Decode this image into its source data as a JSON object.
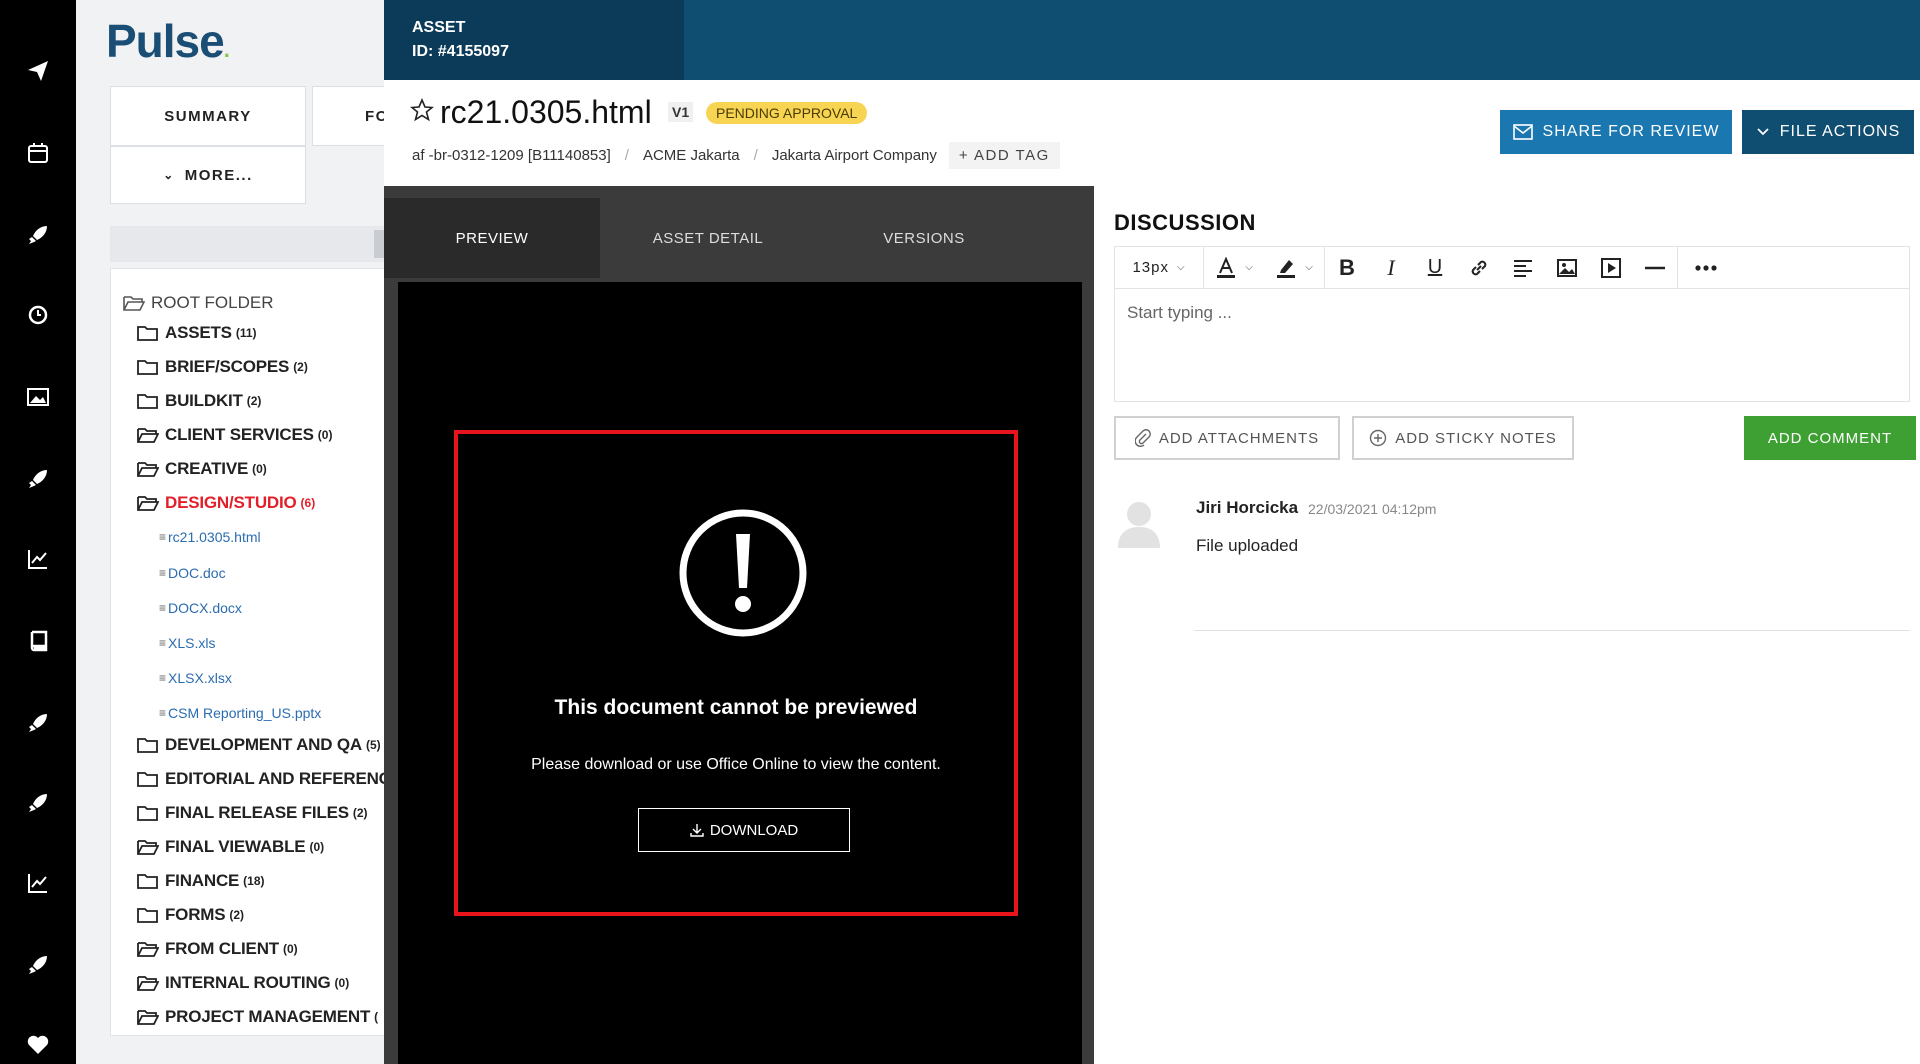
{
  "app": {
    "logo_text": "Pulse",
    "logo_dot": "."
  },
  "rail": {
    "icons": [
      "paper-plane-icon",
      "calendar-icon",
      "rocket-icon",
      "clock-icon",
      "image-icon",
      "rocket-icon",
      "chart-line-icon",
      "book-icon",
      "rocket-icon",
      "rocket-icon",
      "chart-line-icon",
      "rocket-icon",
      "heart-icon"
    ]
  },
  "folder_panel": {
    "tabs": {
      "summary": "SUMMARY",
      "second": "FO",
      "more": "MORE..."
    },
    "root": "ROOT FOLDER",
    "folders": [
      {
        "name": "ASSETS",
        "count": "(11)"
      },
      {
        "name": "BRIEF/SCOPES",
        "count": "(2)"
      },
      {
        "name": "BUILDKIT",
        "count": "(2)"
      },
      {
        "name": "CLIENT SERVICES",
        "count": "(0)"
      },
      {
        "name": "CREATIVE",
        "count": "(0)"
      },
      {
        "name": "DESIGN/STUDIO",
        "count": "(6)",
        "active": true
      },
      {
        "name": "DEVELOPMENT AND QA",
        "count": "(5)"
      },
      {
        "name": "EDITORIAL AND REFERENCE",
        "count": ""
      },
      {
        "name": "FINAL RELEASE FILES",
        "count": "(2)"
      },
      {
        "name": "FINAL VIEWABLE",
        "count": "(0)"
      },
      {
        "name": "FINANCE",
        "count": "(18)"
      },
      {
        "name": "FORMS",
        "count": "(2)"
      },
      {
        "name": "FROM CLIENT",
        "count": "(0)"
      },
      {
        "name": "INTERNAL ROUTING",
        "count": "(0)"
      },
      {
        "name": "PROJECT MANAGEMENT",
        "count": "("
      }
    ],
    "files": [
      "rc21.0305.html",
      "DOC.doc",
      "DOCX.docx",
      "XLS.xls",
      "XLSX.xlsx",
      "CSM Reporting_US.pptx"
    ]
  },
  "asset": {
    "label": "ASSET",
    "id": "ID: #4155097",
    "title": "rc21.0305.html",
    "version": "V1",
    "status": "PENDING APPROVAL",
    "breadcrumb": [
      "af -br-0312-1209 [B11140853]",
      "ACME Jakarta",
      "Jakarta Airport Company"
    ],
    "add_tag": "+ ADD TAG",
    "share_button": "SHARE FOR REVIEW",
    "file_actions_button": "FILE ACTIONS"
  },
  "preview": {
    "tabs": [
      "PREVIEW",
      "ASSET DETAIL",
      "VERSIONS"
    ],
    "error_title": "This document cannot be previewed",
    "error_message": "Please download or use Office Online to view the content.",
    "download_label": "DOWNLOAD"
  },
  "discussion": {
    "title": "DISCUSSION",
    "font_size": "13px",
    "placeholder": "Start typing ...",
    "attach_label": "ADD ATTACHMENTS",
    "sticky_label": "ADD STICKY NOTES",
    "add_comment_label": "ADD COMMENT",
    "comments": [
      {
        "author": "Jiri Horcicka",
        "time": "22/03/2021 04:12pm",
        "text": "File uploaded"
      }
    ]
  },
  "colors": {
    "brand_navy": "#0f4d71",
    "share_blue": "#1a77b0",
    "status_yellow": "#f7d553",
    "highlight_red": "#e8141c",
    "comment_green": "#3ea033",
    "active_folder_red": "#e2202a"
  }
}
